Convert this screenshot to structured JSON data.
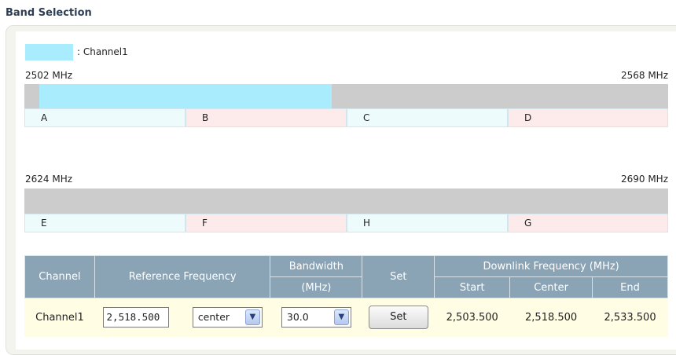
{
  "title": "Band Selection",
  "legend": {
    "label": ": Channel1",
    "color": "#a9ecfd"
  },
  "band1": {
    "start_label": "2502 MHz",
    "end_label": "2568 MHz",
    "segments": [
      "A",
      "B",
      "C",
      "D"
    ]
  },
  "band2": {
    "start_label": "2624 MHz",
    "end_label": "2690 MHz",
    "segments": [
      "E",
      "F",
      "H",
      "G"
    ]
  },
  "channel_highlight": {
    "start_mhz": 2503.5,
    "end_mhz": 2533.5
  },
  "table": {
    "headers": {
      "channel": "Channel",
      "reference_frequency": "Reference Frequency",
      "bandwidth_line1": "Bandwidth",
      "bandwidth_line2": "(MHz)",
      "set": "Set",
      "downlink": "Downlink Frequency (MHz)",
      "start": "Start",
      "center": "Center",
      "end": "End"
    },
    "row": {
      "channel": "Channel1",
      "reference_value": "2,518.500",
      "reference_mode": "center",
      "bandwidth": "30.0",
      "set_label": "Set",
      "start": "2,503.500",
      "center": "2,518.500",
      "end": "2,533.500"
    }
  }
}
